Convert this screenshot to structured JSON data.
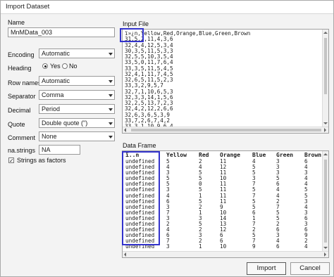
{
  "window": {
    "title": "Import Dataset"
  },
  "form": {
    "name_label": "Name",
    "name_value": "MnMData_003",
    "encoding_label": "Encoding",
    "encoding_value": "Automatic",
    "heading_label": "Heading",
    "heading_yes": "Yes",
    "heading_no": "No",
    "heading_selected": "Yes",
    "rownames_label": "Row names",
    "rownames_value": "Automatic",
    "separator_label": "Separator",
    "separator_value": "Comma",
    "decimal_label": "Decimal",
    "decimal_value": "Period",
    "quote_label": "Quote",
    "quote_value": "Double quote (\")",
    "comment_label": "Comment",
    "comment_value": "None",
    "nastrings_label": "na.strings",
    "nastrings_value": "NA",
    "strings_factors_label": "Strings as factors",
    "strings_factors_checked": true
  },
  "input_file": {
    "label": "Input File",
    "lines": [
      "ï»¿n,Yellow,Red,Orange,Blue,Green,Brown",
      "31,5,2,11,4,3,6",
      "32,4,4,12,5,3,4",
      "30,3,5,11,5,3,3",
      "32,5,5,10,3,5,4",
      "33,5,0,11,7,6,4",
      "33,3,5,11,5,4,5",
      "32,4,1,11,7,4,5",
      "32,6,5,11,5,2,3",
      "33,3,2,9,5,7",
      "32,7,1,10,6,5,3",
      "32,3,3,14,1,5,6",
      "32,2,5,13,7,2,3",
      "32,4,2,12,2,6,6",
      "32,6,3,6,5,3,9",
      "33,7,2,6,7,4,2",
      "33,3,1,10,9,6,4"
    ]
  },
  "data_frame": {
    "label": "Data Frame",
    "headers": [
      "ï..n",
      "Yellow",
      "Red",
      "Orange",
      "Blue",
      "Green",
      "Brown"
    ],
    "rows": [
      [
        "undefined",
        "5",
        "2",
        "11",
        "4",
        "3",
        "6"
      ],
      [
        "undefined",
        "4",
        "4",
        "12",
        "5",
        "3",
        "4"
      ],
      [
        "undefined",
        "3",
        "5",
        "11",
        "5",
        "3",
        "3"
      ],
      [
        "undefined",
        "5",
        "5",
        "10",
        "3",
        "5",
        "4"
      ],
      [
        "undefined",
        "5",
        "0",
        "11",
        "7",
        "6",
        "4"
      ],
      [
        "undefined",
        "3",
        "5",
        "11",
        "5",
        "4",
        "5"
      ],
      [
        "undefined",
        "4",
        "1",
        "11",
        "7",
        "4",
        "5"
      ],
      [
        "undefined",
        "6",
        "5",
        "11",
        "5",
        "2",
        "3"
      ],
      [
        "undefined",
        "3",
        "2",
        "9",
        "5",
        "7",
        "4"
      ],
      [
        "undefined",
        "7",
        "1",
        "10",
        "6",
        "5",
        "3"
      ],
      [
        "undefined",
        "3",
        "3",
        "14",
        "1",
        "5",
        "6"
      ],
      [
        "undefined",
        "2",
        "5",
        "13",
        "7",
        "2",
        "3"
      ],
      [
        "undefined",
        "4",
        "2",
        "12",
        "2",
        "6",
        "6"
      ],
      [
        "undefined",
        "6",
        "3",
        "6",
        "5",
        "3",
        "9"
      ],
      [
        "undefined",
        "7",
        "2",
        "6",
        "7",
        "4",
        "2"
      ],
      [
        "undefined",
        "3",
        "1",
        "10",
        "9",
        "6",
        "4"
      ]
    ]
  },
  "buttons": {
    "import": "Import",
    "cancel": "Cancel"
  },
  "colors": {
    "highlight": "#3333cc",
    "window_bg": "#f3f3f3"
  }
}
